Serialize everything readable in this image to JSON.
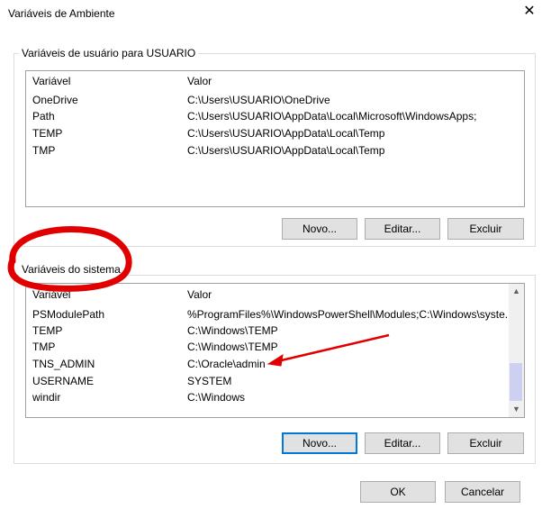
{
  "window": {
    "title": "Variáveis de Ambiente",
    "close_glyph": "✕"
  },
  "user_vars": {
    "legend": "Variáveis de usuário para USUARIO",
    "columns": [
      "Variável",
      "Valor"
    ],
    "rows": [
      {
        "name": "OneDrive",
        "value": "C:\\Users\\USUARIO\\OneDrive"
      },
      {
        "name": "Path",
        "value": "C:\\Users\\USUARIO\\AppData\\Local\\Microsoft\\WindowsApps;"
      },
      {
        "name": "TEMP",
        "value": "C:\\Users\\USUARIO\\AppData\\Local\\Temp"
      },
      {
        "name": "TMP",
        "value": "C:\\Users\\USUARIO\\AppData\\Local\\Temp"
      }
    ],
    "buttons": {
      "new": "Novo...",
      "edit": "Editar...",
      "delete": "Excluir"
    }
  },
  "system_vars": {
    "legend": "Variáveis do sistema",
    "columns": [
      "Variável",
      "Valor"
    ],
    "rows": [
      {
        "name": "PSModulePath",
        "value": "%ProgramFiles%\\WindowsPowerShell\\Modules;C:\\Windows\\syste..."
      },
      {
        "name": "TEMP",
        "value": "C:\\Windows\\TEMP"
      },
      {
        "name": "TMP",
        "value": "C:\\Windows\\TEMP"
      },
      {
        "name": "TNS_ADMIN",
        "value": "C:\\Oracle\\admin"
      },
      {
        "name": "USERNAME",
        "value": "SYSTEM"
      },
      {
        "name": "windir",
        "value": "C:\\Windows"
      }
    ],
    "buttons": {
      "new": "Novo...",
      "edit": "Editar...",
      "delete": "Excluir"
    },
    "scroll_up": "▲",
    "scroll_down": "▼"
  },
  "footer": {
    "ok": "OK",
    "cancel": "Cancelar"
  },
  "annotation": {
    "circle_color": "#e00000",
    "arrow_color": "#e00000"
  }
}
